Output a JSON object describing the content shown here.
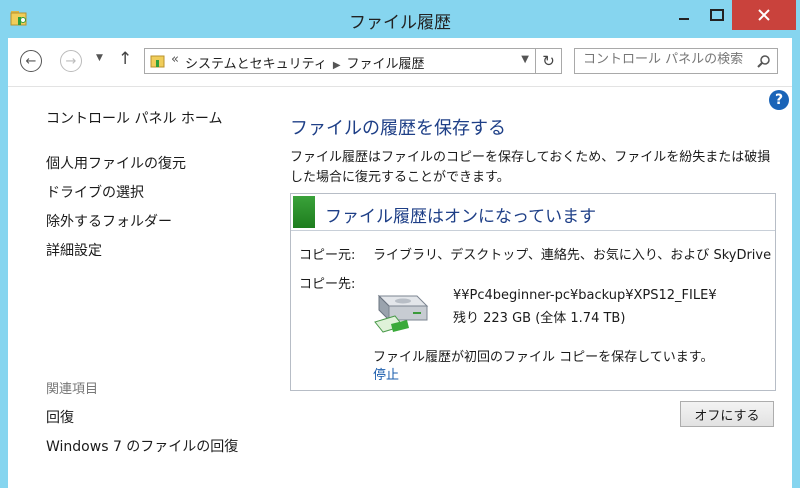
{
  "window": {
    "title": "ファイル履歴"
  },
  "nav": {
    "breadcrumb_chevron": "«",
    "breadcrumb": [
      "システムとセキュリティ",
      "ファイル履歴"
    ],
    "search_placeholder": "コントロール パネルの検索"
  },
  "sidebar": {
    "home": "コントロール パネル ホーム",
    "items": [
      "個人用ファイルの復元",
      "ドライブの選択",
      "除外するフォルダー",
      "詳細設定"
    ],
    "related_heading": "関連項目",
    "related": [
      "回復",
      "Windows 7 のファイルの回復"
    ]
  },
  "main": {
    "title": "ファイルの履歴を保存する",
    "description": "ファイル履歴はファイルのコピーを保存しておくため、ファイルを紛失または破損した場合に復元することができます。",
    "status": "ファイル履歴はオンになっています",
    "copy_from_label": "コピー元:",
    "copy_from_value": "ライブラリ、デスクトップ、連絡先、お気に入り、および SkyDrive",
    "copy_to_label": "コピー先:",
    "dest_path": "¥¥Pc4beginner-pc¥backup¥XPS12_FILE¥",
    "dest_space": "残り 223 GB (全体 1.74 TB)",
    "progress_text": "ファイル履歴が初回のファイル コピーを保存しています。",
    "stop_link": "停止",
    "off_button": "オフにする"
  },
  "colors": {
    "accent_blue": "#1e3f87",
    "link": "#1a5cad",
    "status_green": "#2a9a2a",
    "close_red": "#c9423c",
    "frame": "#86d5ef"
  }
}
